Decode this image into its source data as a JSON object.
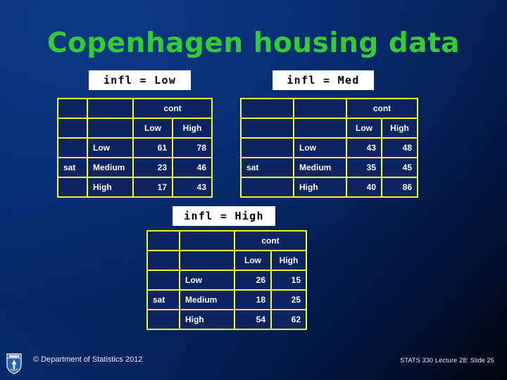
{
  "slide": {
    "title": "Copenhagen housing data",
    "background_top_color": "#06347f",
    "background_bottom_color": "#000309",
    "title_color": "#33cc33",
    "table_border_color": "#f5f527",
    "table_cell_color": "#0c2461",
    "table_text_color": "#ffffff"
  },
  "captions": {
    "low": "infl = Low",
    "med": "infl = Med",
    "high": "infl = High"
  },
  "tables": [
    {
      "id": "low",
      "caption": "infl = Low",
      "corner_label": "sat",
      "span_header": "cont",
      "col_headers": [
        "Low",
        "High"
      ],
      "row_labels": [
        "Low",
        "Medium",
        "High"
      ],
      "values": [
        [
          61,
          78
        ],
        [
          23,
          46
        ],
        [
          17,
          43
        ]
      ]
    },
    {
      "id": "med",
      "caption": "infl = Med",
      "corner_label": "sat",
      "span_header": "cont",
      "col_headers": [
        "Low",
        "High"
      ],
      "row_labels": [
        "Low",
        "Medium",
        "High"
      ],
      "values": [
        [
          43,
          48
        ],
        [
          35,
          45
        ],
        [
          40,
          86
        ]
      ]
    },
    {
      "id": "high",
      "caption": "infl = High",
      "corner_label": "sat",
      "span_header": "cont",
      "col_headers": [
        "Low",
        "High"
      ],
      "row_labels": [
        "Low",
        "Medium",
        "High"
      ],
      "values": [
        [
          26,
          15
        ],
        [
          18,
          25
        ],
        [
          54,
          62
        ]
      ]
    }
  ],
  "footer": {
    "copyright": "© Department of Statistics 2012",
    "slide_ref": "STATS 330 Lecture 28: Slide 25",
    "logo_icon": "university-crest-icon"
  }
}
